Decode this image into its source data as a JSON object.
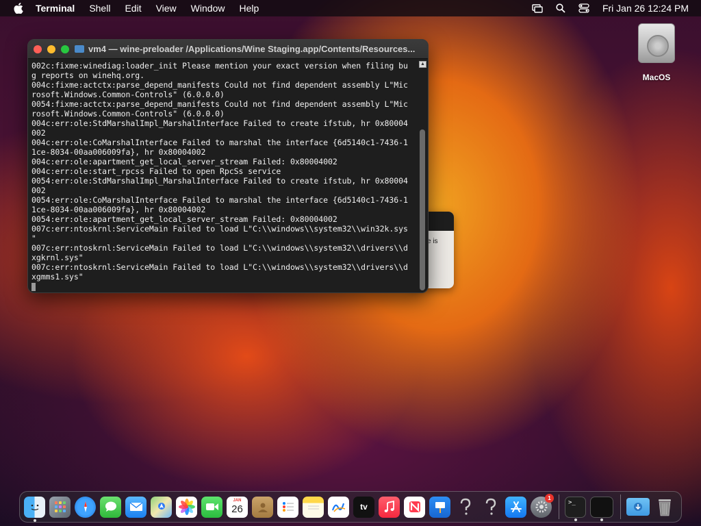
{
  "menubar": {
    "app_name": "Terminal",
    "items": [
      "Shell",
      "Edit",
      "View",
      "Window",
      "Help"
    ],
    "clock": "Fri Jan 26  12:24 PM"
  },
  "desktop": {
    "disk_label": "MacOS"
  },
  "background_dialog": {
    "fragment_text": "e is"
  },
  "terminal": {
    "title": "vm4 — wine-preloader /Applications/Wine Staging.app/Contents/Resources...",
    "lines": [
      "002c:fixme:winediag:loader_init Please mention your exact version when filing bu",
      "g reports on winehq.org.",
      "004c:fixme:actctx:parse_depend_manifests Could not find dependent assembly L\"Mic",
      "rosoft.Windows.Common-Controls\" (6.0.0.0)",
      "0054:fixme:actctx:parse_depend_manifests Could not find dependent assembly L\"Mic",
      "rosoft.Windows.Common-Controls\" (6.0.0.0)",
      "004c:err:ole:StdMarshalImpl_MarshalInterface Failed to create ifstub, hr 0x80004",
      "002",
      "004c:err:ole:CoMarshalInterface Failed to marshal the interface {6d5140c1-7436-1",
      "1ce-8034-00aa006009fa}, hr 0x80004002",
      "004c:err:ole:apartment_get_local_server_stream Failed: 0x80004002",
      "004c:err:ole:start_rpcss Failed to open RpcSs service",
      "0054:err:ole:StdMarshalImpl_MarshalInterface Failed to create ifstub, hr 0x80004",
      "002",
      "0054:err:ole:CoMarshalInterface Failed to marshal the interface {6d5140c1-7436-1",
      "1ce-8034-00aa006009fa}, hr 0x80004002",
      "0054:err:ole:apartment_get_local_server_stream Failed: 0x80004002",
      "007c:err:ntoskrnl:ServiceMain Failed to load L\"C:\\\\windows\\\\system32\\\\win32k.sys",
      "\"",
      "007c:err:ntoskrnl:ServiceMain Failed to load L\"C:\\\\windows\\\\system32\\\\drivers\\\\d",
      "xgkrnl.sys\"",
      "007c:err:ntoskrnl:ServiceMain Failed to load L\"C:\\\\windows\\\\system32\\\\drivers\\\\d",
      "xgmms1.sys\""
    ]
  },
  "dock": {
    "calendar_month": "JAN",
    "calendar_day": "26",
    "tv_label": "tv",
    "settings_badge": "1"
  },
  "colors": {
    "close": "#fe5f57",
    "minimize": "#febc2e",
    "zoom": "#28c840",
    "terminal_bg": "#1e1e1e"
  }
}
